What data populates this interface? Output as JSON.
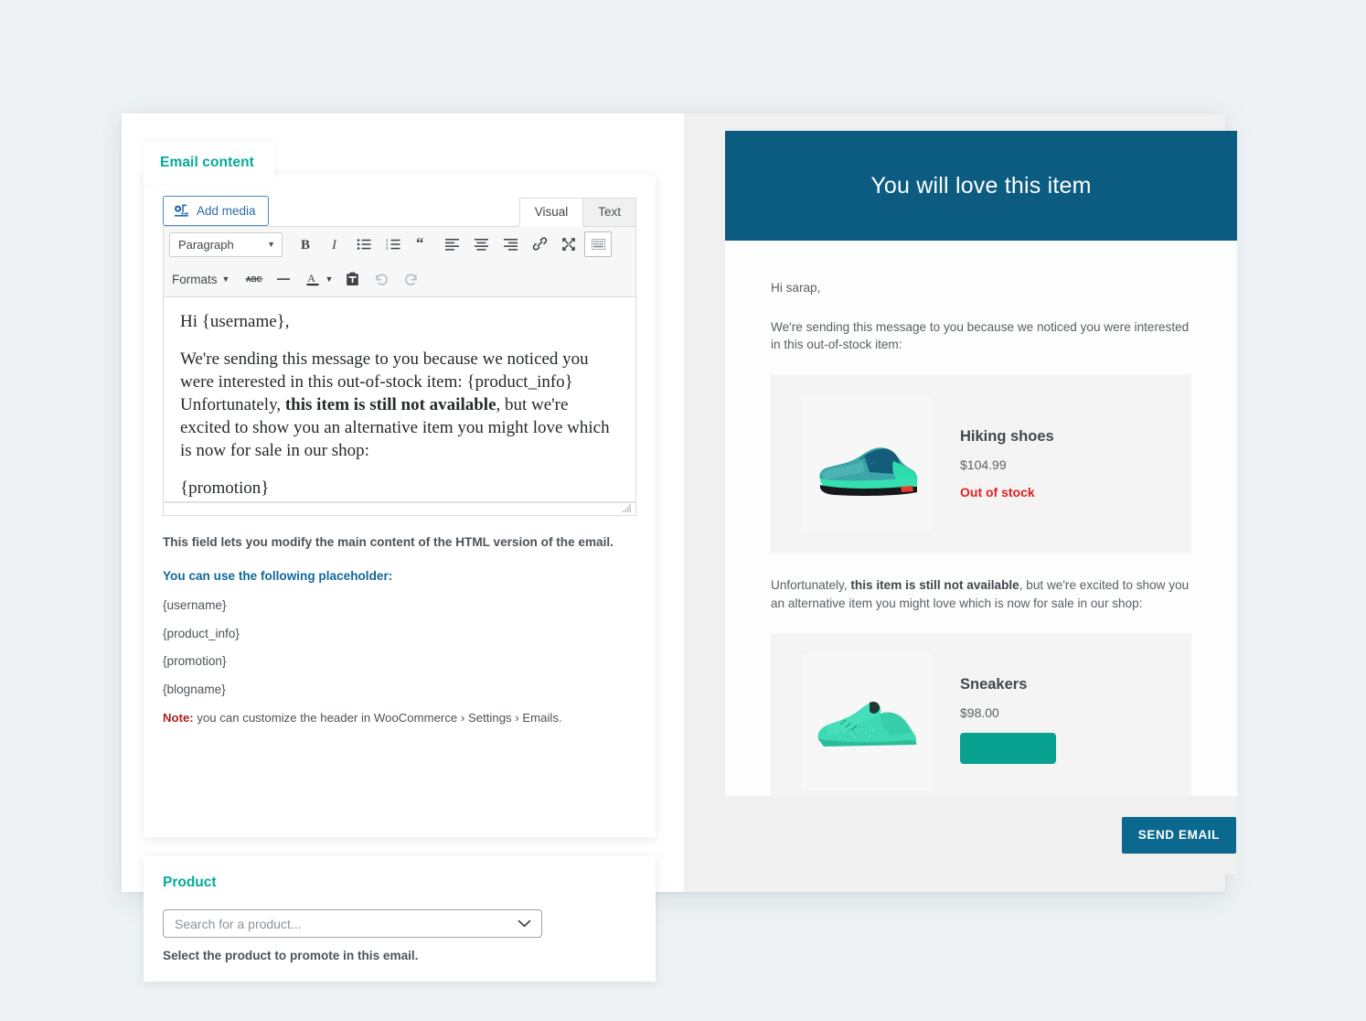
{
  "left_panel": {
    "tab": {
      "label": "Email content"
    },
    "editor": {
      "add_media_label": "Add media",
      "mode_tabs": [
        {
          "label": "Visual",
          "active": true
        },
        {
          "label": "Text",
          "active": false
        }
      ],
      "toolbar": {
        "paragraph_select": "Paragraph",
        "formats_label": "Formats",
        "buttons": [
          "bold-icon",
          "italic-icon",
          "bulleted-list-icon",
          "numbered-list-icon",
          "blockquote-icon",
          "align-left-icon",
          "align-center-icon",
          "align-right-icon",
          "insert-link-icon",
          "fullscreen-icon",
          "toolbar-toggle-icon",
          "strikethrough-icon",
          "horizontal-rule-icon",
          "text-color-icon",
          "paste-as-text-icon",
          "undo-icon",
          "redo-icon"
        ]
      },
      "content": {
        "greeting": "Hi {username},",
        "para2_a": "We're sending this message to you because we noticed you were interested in this out-of-stock item: {product_info}",
        "para2_b": "Unfortunately, ",
        "para2_bold": "this item is still not available",
        "para2_c": ", but we're excited to show you an alternative item you might love which is now for sale in our shop:",
        "para3": "{promotion}"
      }
    },
    "help_text": "This field lets you modify the main content of the HTML version of the email.",
    "placeholder_heading": "You can use the following placeholder:",
    "placeholders": [
      "{username}",
      "{product_info}",
      "{promotion}",
      "{blogname}"
    ],
    "note": {
      "keyword": "Note:",
      "text": " you can customize the header in WooCommerce › Settings › Emails."
    },
    "product_section": {
      "title": "Product",
      "search_placeholder": "Search for a product...",
      "help": "Select the product to promote in this email."
    }
  },
  "preview": {
    "header_title": "You will love this item",
    "greeting": "Hi sarap,",
    "intro": "We're sending this message to you because we noticed you were interested in this out-of-stock item:",
    "mid_a": "Unfortunately, ",
    "mid_bold": "this item is still not available",
    "mid_b": ", but we're excited to show you an alternative item you might love which is now for sale in our shop:",
    "products": [
      {
        "name": "Hiking shoes",
        "price": "$104.99",
        "status": "Out of stock"
      },
      {
        "name": "Sneakers",
        "price": "$98.00",
        "status": ""
      }
    ],
    "send_button": "SEND EMAIL"
  },
  "colors": {
    "accent_teal": "#04ab97",
    "link_blue": "#11689a",
    "mail_header_blue": "#0b5c80",
    "send_button_blue": "#0b688e",
    "buy_button_teal": "#08a08e",
    "out_of_stock_red": "#e02020",
    "note_red": "#b32020"
  }
}
